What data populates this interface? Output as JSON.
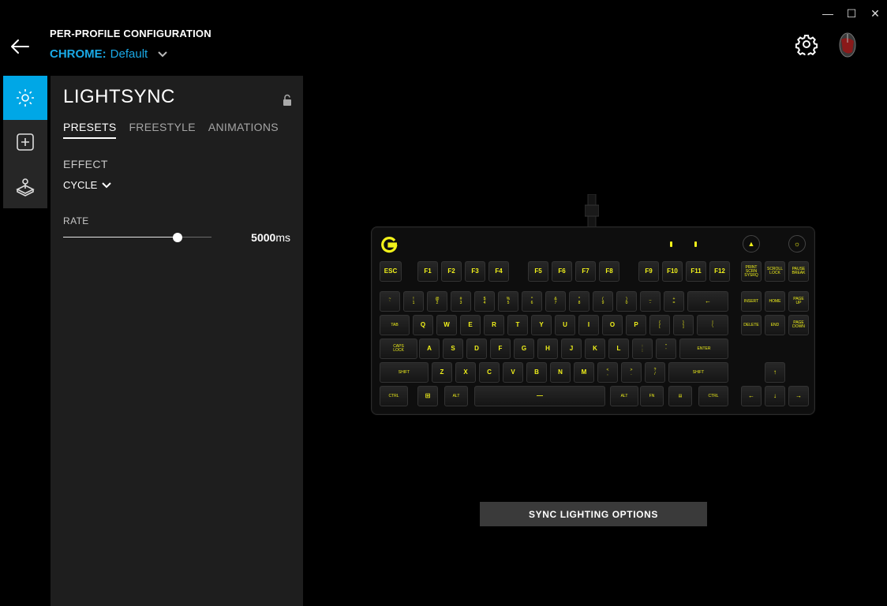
{
  "window": {
    "minimize": "—",
    "maximize": "☐",
    "close": "✕"
  },
  "header": {
    "title": "PER-PROFILE CONFIGURATION",
    "profile_key": "CHROME:",
    "profile_value": "Default"
  },
  "rail": {
    "items": [
      {
        "icon": "lightsync-icon",
        "active": true
      },
      {
        "icon": "assignments-icon",
        "active": false
      },
      {
        "icon": "game-mode-icon",
        "active": false
      }
    ]
  },
  "panel": {
    "title": "LIGHTSYNC",
    "tabs": [
      "PRESETS",
      "FREESTYLE",
      "ANIMATIONS"
    ],
    "active_tab": "PRESETS",
    "effect_label": "EFFECT",
    "effect_value": "CYCLE",
    "rate_label": "RATE",
    "rate_value": "5000",
    "rate_unit": "ms",
    "rate_fraction": 0.77
  },
  "keyboard": {
    "accent_color": "#f2f21a",
    "keys": [
      "ESC",
      "F1",
      "F2",
      "F3",
      "F4",
      "F5",
      "F6",
      "F7",
      "F8",
      "F9",
      "F10",
      "F11",
      "F12",
      "PRINT SCRN SYSRQ",
      "SCROLL LOCK",
      "PAUSE BREAK",
      "~ `",
      "! 1",
      "@ 2",
      "# 3",
      "$ 4",
      "% 5",
      "^ 6",
      "& 7",
      "* 8",
      "( 9",
      ") 0",
      "_ -",
      "+ =",
      "←",
      "INSERT",
      "HOME",
      "PAGE UP",
      "TAB",
      "Q",
      "W",
      "E",
      "R",
      "T",
      "Y",
      "U",
      "I",
      "O",
      "P",
      "{ [",
      "} ]",
      "| \\",
      "DELETE",
      "END",
      "PAGE DOWN",
      "CAPS LOCK",
      "A",
      "S",
      "D",
      "F",
      "G",
      "H",
      "J",
      "K",
      "L",
      ": ;",
      "\" '",
      "ENTER",
      "SHIFT",
      "Z",
      "X",
      "C",
      "V",
      "B",
      "N",
      "M",
      "< ,",
      "> .",
      "? /",
      "SHIFT",
      "↑",
      "CTRL",
      "⊞",
      "ALT",
      "—",
      "ALT",
      "FN",
      "▤",
      "CTRL",
      "←",
      "↓",
      "→"
    ]
  },
  "sync_button": "SYNC LIGHTING OPTIONS"
}
